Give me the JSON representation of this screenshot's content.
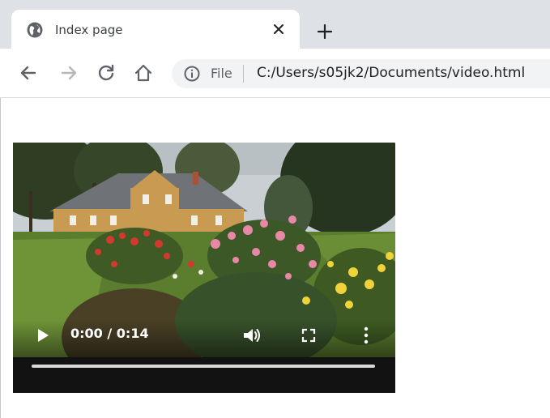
{
  "tab": {
    "title": "Index page"
  },
  "address_bar": {
    "chip_label": "File",
    "url": "C:/Users/s05jk2/Documents/video.html"
  },
  "video": {
    "current_time": "0:00",
    "duration": "0:14",
    "time_display": "0:00 / 0:14",
    "progress": 0.0
  },
  "icons": {
    "tab_favicon": "globe-icon",
    "tab_close": "close-icon",
    "new_tab": "plus-icon",
    "back": "arrow-left-icon",
    "forward": "arrow-right-icon",
    "reload": "reload-icon",
    "home": "home-icon",
    "site_info": "info-icon",
    "play": "play-icon",
    "volume": "volume-icon",
    "fullscreen": "fullscreen-icon",
    "more": "more-vert-icon"
  },
  "colors": {
    "tabstrip": "#dee1e6",
    "omnibox": "#f1f3f4",
    "icon": "#5f6368",
    "forward_disabled": "#b5b8bb"
  }
}
